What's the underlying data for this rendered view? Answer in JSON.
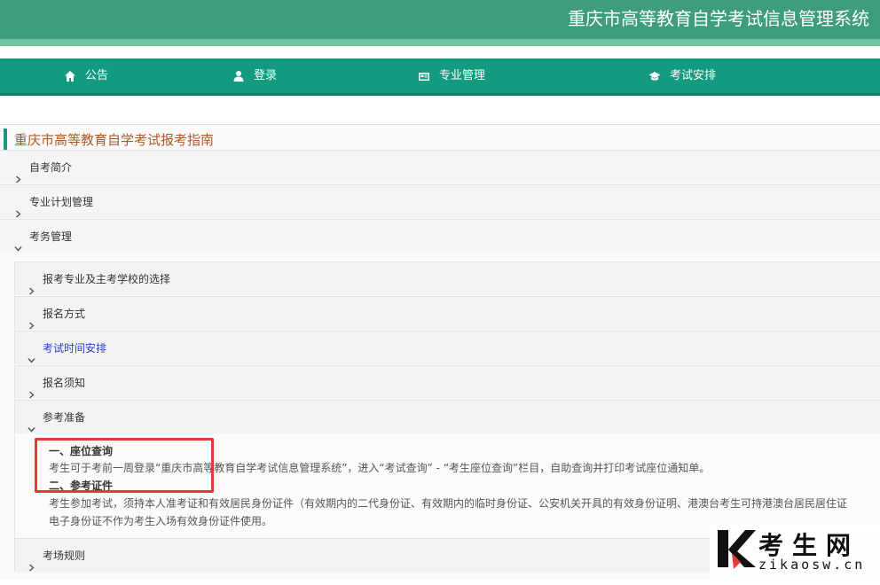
{
  "header": {
    "title": "重庆市高等教育自学考试信息管理系统"
  },
  "nav": {
    "items": [
      {
        "label": "公告",
        "icon": "home-icon"
      },
      {
        "label": "登录",
        "icon": "user-icon"
      },
      {
        "label": "专业管理",
        "icon": "newspaper-icon"
      },
      {
        "label": "考试安排",
        "icon": "graduation-cap-icon"
      }
    ]
  },
  "guide": {
    "title": "重庆市高等教育自学考试报考指南",
    "sections": [
      {
        "label": "自考简介"
      },
      {
        "label": "专业计划管理"
      },
      {
        "label": "考务管理"
      }
    ],
    "subsections": [
      {
        "label": "报考专业及主考学校的选择"
      },
      {
        "label": "报名方式"
      },
      {
        "label": "考试时间安排"
      },
      {
        "label": "报名须知"
      },
      {
        "label": "参考准备"
      }
    ],
    "content": {
      "heading1": "一、座位查询",
      "para1": "考生可于考前一周登录“重庆市高等教育自学考试信息管理系统”，进入“考试查询” - “考生座位查询”栏目，自助查询并打印考试座位通知单。",
      "heading2": "二、参考证件",
      "para2a": "考生参加考试，须持本人准考证和有效居民身份证件（有效期内的二代身份证、有效期内的临时身份证、公安机关开具的有效身份证明、港澳台考生可持港澳台居民居住证",
      "para2b": "电子身份证不作为考生入场有效身份证件使用。"
    },
    "last_subsection": {
      "label": "考场规则"
    }
  },
  "watermark": {
    "cn": "考生网",
    "en": "zikaosw.cn"
  },
  "colors": {
    "header": "#3e9d7b",
    "nav": "#139b7f",
    "accent": "#b05a2b",
    "link": "#2a3fd1",
    "highlight": "#e53935"
  }
}
